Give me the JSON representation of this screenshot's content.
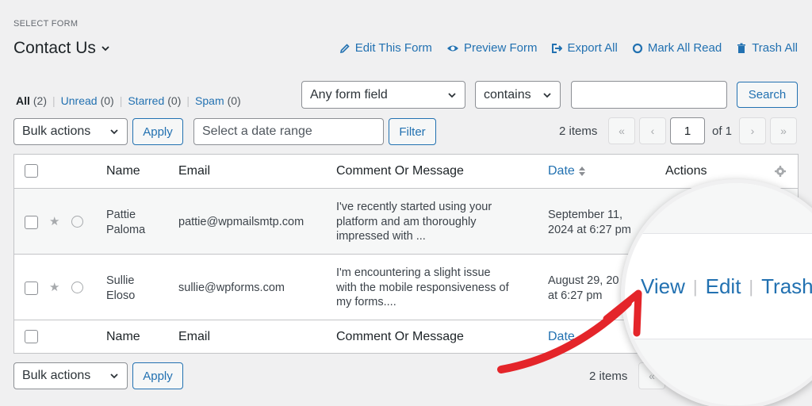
{
  "header": {
    "select_form_label": "SELECT FORM",
    "form_title": "Contact Us",
    "actions": [
      {
        "label": "Edit This Form",
        "icon": "pencil-icon"
      },
      {
        "label": "Preview Form",
        "icon": "eye-icon"
      },
      {
        "label": "Export All",
        "icon": "export-icon"
      },
      {
        "label": "Mark All Read",
        "icon": "circle-icon"
      },
      {
        "label": "Trash All",
        "icon": "trash-icon"
      }
    ]
  },
  "filters": {
    "all": {
      "label": "All",
      "count": "(2)"
    },
    "unread": {
      "label": "Unread",
      "count": "(0)"
    },
    "starred": {
      "label": "Starred",
      "count": "(0)"
    },
    "spam": {
      "label": "Spam",
      "count": "(0)"
    }
  },
  "search": {
    "field_select": "Any form field",
    "operator_select": "contains",
    "input_value": "",
    "button": "Search"
  },
  "toolbar_top": {
    "bulk_actions": "Bulk actions",
    "apply": "Apply",
    "date_placeholder": "Select a date range",
    "filter": "Filter",
    "items": "2 items",
    "first": "«",
    "prev": "‹",
    "page": "1",
    "of": "of 1",
    "next": "›",
    "last": "»"
  },
  "table": {
    "headers": {
      "name": "Name",
      "email": "Email",
      "message": "Comment Or Message",
      "date": "Date",
      "actions": "Actions"
    },
    "rows": [
      {
        "name_line1": "Pattie",
        "name_line2": "Paloma",
        "email": "pattie@wpmailsmtp.com",
        "msg_line1": "I've recently started using your",
        "msg_line2": "platform and am thoroughly",
        "msg_line3": "impressed with ...",
        "date_line1": "September 11,",
        "date_line2": "2024 at 6:27 pm"
      },
      {
        "name_line1": "Sullie",
        "name_line2": "Eloso",
        "email": "sullie@wpforms.com",
        "msg_line1": "I'm encountering a slight issue",
        "msg_line2": "with the mobile responsiveness of",
        "msg_line3": "my forms....",
        "date_line1": "August 29, 20",
        "date_line2": "at 6:27 pm"
      }
    ]
  },
  "toolbar_bottom": {
    "bulk_actions": "Bulk actions",
    "apply": "Apply",
    "items": "2 items",
    "first": "«",
    "last": "»"
  },
  "magnifier": {
    "view": "View",
    "edit": "Edit",
    "trash": "Trash"
  },
  "colors": {
    "link": "#2271b1",
    "arrow": "#e4252a"
  }
}
